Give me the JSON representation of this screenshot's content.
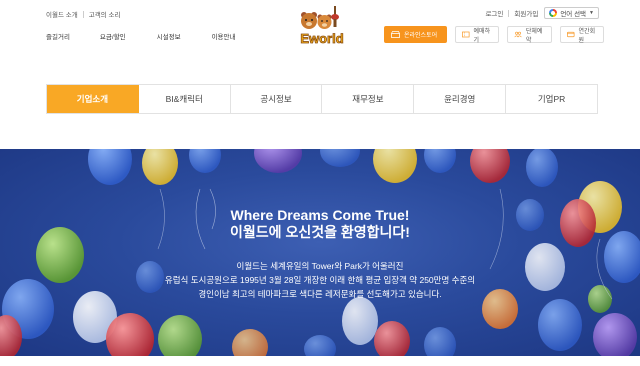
{
  "util_left": [
    "이월드 소개",
    "고객의 소리"
  ],
  "util_right": [
    "로그인",
    "회원가입"
  ],
  "language": {
    "label": "언어 선택",
    "caret": "▼"
  },
  "main_nav": [
    "즐길거리",
    "요금/할인",
    "시설정보",
    "이용안내"
  ],
  "logo_text": "Eworld",
  "cta": [
    {
      "label": "온라인스토어",
      "icon": "store-icon"
    },
    {
      "label": "예매하기",
      "icon": "ticket-icon"
    },
    {
      "label": "단체예약",
      "icon": "group-icon"
    },
    {
      "label": "연간회원",
      "icon": "membership-card-icon"
    }
  ],
  "tabs": [
    "기업소개",
    "BI&캐릭터",
    "공시정보",
    "재무정보",
    "윤리경영",
    "기업PR"
  ],
  "active_tab": 0,
  "hero": {
    "title_en": "Where Dreams Come True!",
    "title_ko": "이월드에 오신것을 환영합니다!",
    "body": [
      "이월드는 세계유일의 Tower와 Park가 어울러진",
      "유럽식 도시공원으로 1995년 3월 28일 개장한 이래 한해 평균 입장객 약 250만명 수준의",
      "경인이남 최고의 테마파크로 색다른 레저문화를 선도해가고 있습니다."
    ]
  },
  "colors": {
    "accent": "#f9a825",
    "cta": "#f7941d",
    "hero_bg": "#2a4a9c"
  }
}
